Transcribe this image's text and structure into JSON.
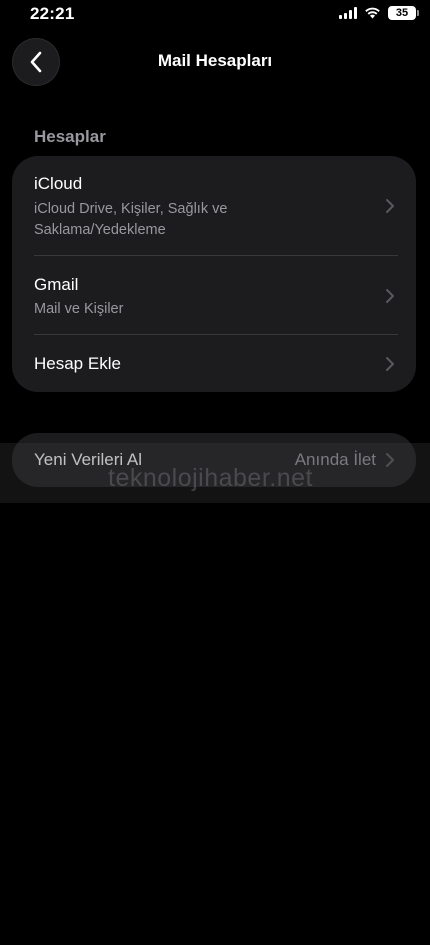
{
  "status_bar": {
    "time": "22:21",
    "battery": "35"
  },
  "nav": {
    "title": "Mail Hesapları"
  },
  "accounts_section": {
    "header": "Hesaplar",
    "rows": [
      {
        "title": "iCloud",
        "subtitle": "iCloud Drive, Kişiler, Sağlık ve Saklama/Yedekleme"
      },
      {
        "title": "Gmail",
        "subtitle": "Mail ve Kişiler"
      },
      {
        "title": "Hesap Ekle"
      }
    ]
  },
  "fetch": {
    "label": "Yeni Verileri Al",
    "value": "Anında İlet"
  },
  "watermark": "teknolojihaber.net",
  "icons": [
    "signal-icon",
    "wifi-icon",
    "battery-icon",
    "back-chevron-icon",
    "chevron-right-icon"
  ]
}
